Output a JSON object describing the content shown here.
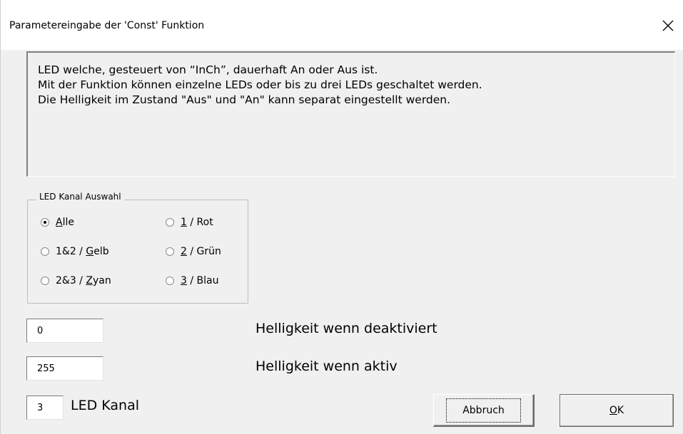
{
  "window": {
    "title": "Parametereingabe der 'Const' Funktion"
  },
  "description": {
    "lines": [
      "LED welche, gesteuert von “InCh”, dauerhaft An oder Aus ist.",
      "Mit der Funktion können einzelne LEDs oder bis zu drei LEDs geschaltet werden.",
      "Die Helligkeit im Zustand \"Aus\" und \"An\" kann separat eingestellt werden."
    ]
  },
  "channel_group": {
    "label": "LED Kanal Auswahl",
    "options": [
      {
        "mnemonic": "A",
        "rest": "lle",
        "prefix": "",
        "checked": true
      },
      {
        "prefix": "",
        "mnemonic": "1",
        "rest": " / Rot",
        "checked": false
      },
      {
        "prefix": "1&2 / ",
        "mnemonic": "G",
        "rest": "elb",
        "checked": false
      },
      {
        "prefix": "",
        "mnemonic": "2",
        "rest": " / Grün",
        "checked": false
      },
      {
        "prefix": "2&3 / ",
        "mnemonic": "Z",
        "rest": "yan",
        "checked": false
      },
      {
        "prefix": "",
        "mnemonic": "3",
        "rest": " / Blau",
        "checked": false
      }
    ]
  },
  "brightness_off": {
    "value": "0",
    "label": "Helligkeit wenn deaktiviert"
  },
  "brightness_on": {
    "value": "255",
    "label": "Helligkeit wenn aktiv"
  },
  "led_channel": {
    "value": "3",
    "label": "LED Kanal"
  },
  "buttons": {
    "cancel": "Abbruch",
    "ok_mnemonic": "O",
    "ok_rest": "K"
  }
}
